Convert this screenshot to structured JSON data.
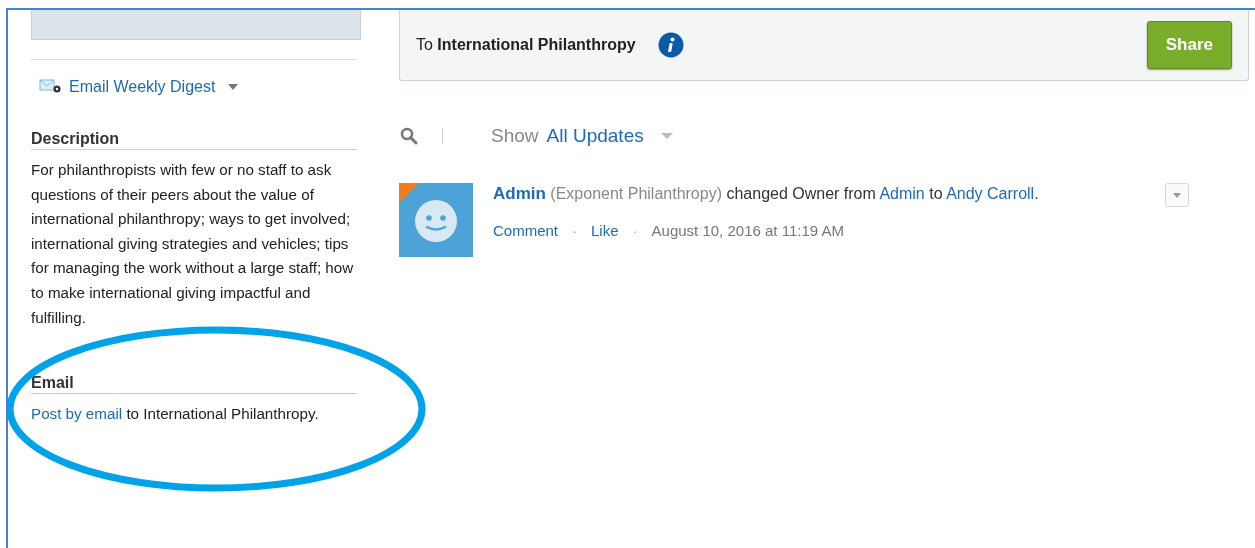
{
  "sidebar": {
    "digest": {
      "label": "Email Weekly Digest"
    },
    "sections": [
      {
        "kind": "text",
        "heading": "Description",
        "text": "For philanthropists with few or no staff to ask questions of their peers about the value of international philanthropy; ways to get involved; international giving strategies and vehicles; tips for managing the work without a large staff; how to make international giving impactful and fulfilling."
      },
      {
        "kind": "link",
        "heading": "Email",
        "link": "Post by email",
        "text": " to International Philanthropy."
      }
    ]
  },
  "publisher": {
    "prefix": "To",
    "group": "International Philanthropy",
    "button": "Share"
  },
  "filter": {
    "label": "Show",
    "value": "All Updates"
  },
  "feed": [
    {
      "parts": [
        {
          "kind": "author",
          "text": "Admin"
        },
        {
          "kind": "muted",
          "text": " (Exponent Philanthropy) "
        },
        {
          "kind": "plain",
          "text": "changed Owner from "
        },
        {
          "kind": "link",
          "text": "Admin"
        },
        {
          "kind": "plain",
          "text": " to "
        },
        {
          "kind": "link",
          "text": "Andy Carroll"
        },
        {
          "kind": "plain",
          "text": "."
        }
      ],
      "actions": [
        "Comment",
        "Like"
      ],
      "separator": "·",
      "timestamp": "August 10, 2016 at 11:19 AM"
    }
  ],
  "annotation": {
    "kind": "ellipse",
    "color": "#00a2e8"
  }
}
